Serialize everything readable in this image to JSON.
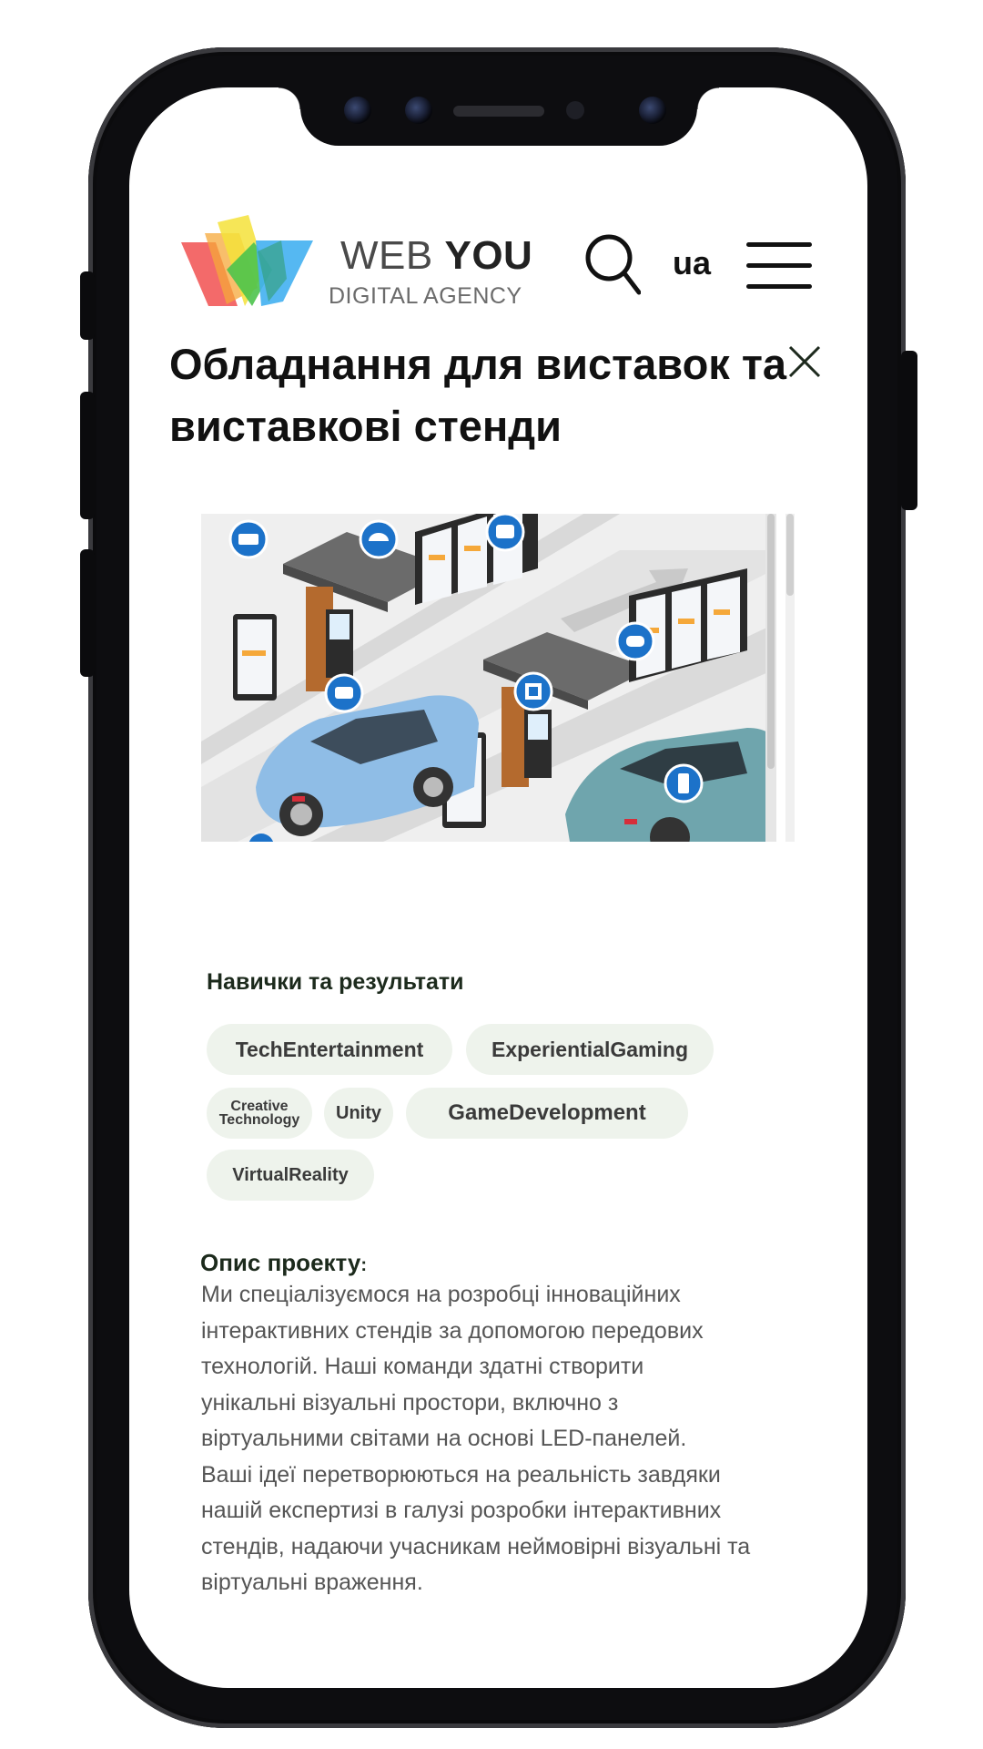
{
  "header": {
    "logo_web": "WEB",
    "logo_you": "YOU",
    "logo_sub": "DIGITAL AGENCY",
    "lang": "ua"
  },
  "page_title": "Обладнання для виставок та виставкові стенди",
  "image": {
    "description_icons": [
      "card-reader-icon",
      "dome-camera-icon",
      "robot-icon",
      "chat-icon",
      "qr-code-icon",
      "burger-icon",
      "phone-icon"
    ]
  },
  "skills": {
    "title": "Навички та результати",
    "tags": [
      "TechEntertainment",
      "ExperientialGaming",
      "Creative Technology",
      "Unity",
      "GameDevelopment",
      "VirtualReality"
    ]
  },
  "description": {
    "title": "Опис проекту",
    "colon": ":",
    "text": "Ми спеціалізуємося на розробці інноваційних\nінтерактивних стендів за допомогою передових\nтехнологій.  Наші команди здатні створити\nунікальні візуальні простори, включно з\nвіртуальними світами на основі LED-панелей.\nВаші ідеї перетворюються на реальність завдяки\nнашій експертизі в галузі розробки інтерактивних\nстендів, надаючи учасникам неймовірні візуальні та\nвіртуальні враження."
  },
  "colors": {
    "brand_red": "#f25a5a",
    "brand_yellow": "#f5e23a",
    "brand_green": "#4cc34c",
    "brand_blue": "#43b0f1",
    "tag_bg": "#eef3ec",
    "icon_blue": "#1c72c9"
  }
}
